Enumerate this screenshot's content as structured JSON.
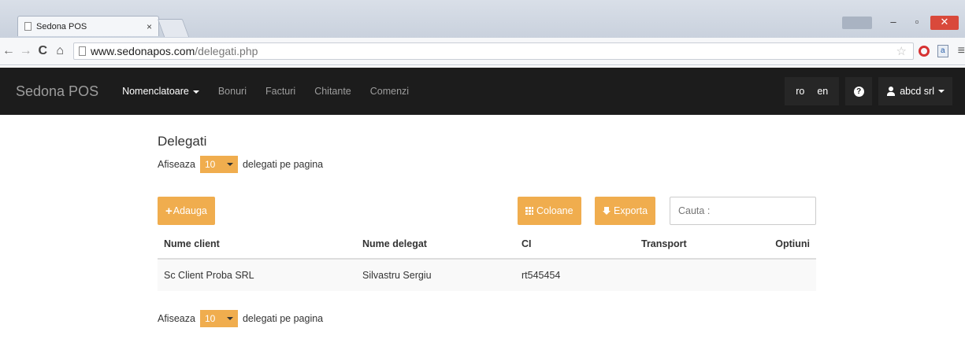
{
  "browser": {
    "tab_title": "Sedona POS",
    "tab_close": "×",
    "url_domain": "www.sedonapos.com",
    "url_path": "/delegati.php"
  },
  "navbar": {
    "brand": "Sedona POS",
    "items": [
      {
        "label": "Nomenclatoare",
        "active": true,
        "dropdown": true
      },
      {
        "label": "Bonuri"
      },
      {
        "label": "Facturi"
      },
      {
        "label": "Chitante"
      },
      {
        "label": "Comenzi"
      }
    ],
    "languages": [
      "ro",
      "en"
    ],
    "user": "abcd srl"
  },
  "page": {
    "title": "Delegati",
    "pager_prefix": "Afiseaza",
    "pager_value": "10",
    "pager_suffix": "delegati pe pagina",
    "add_button": "Adauga",
    "columns_button": "Coloane",
    "export_button": "Exporta",
    "search_placeholder": "Cauta :"
  },
  "table": {
    "headers": [
      "Nume client",
      "Nume delegat",
      "CI",
      "Transport",
      "Optiuni"
    ],
    "rows": [
      [
        "Sc Client Proba SRL",
        "Silvastru Sergiu",
        "rt545454",
        "",
        ""
      ]
    ]
  },
  "colors": {
    "accent": "#f0ad4e",
    "navbar": "#1c1c1c",
    "close_button": "#d9493b"
  }
}
